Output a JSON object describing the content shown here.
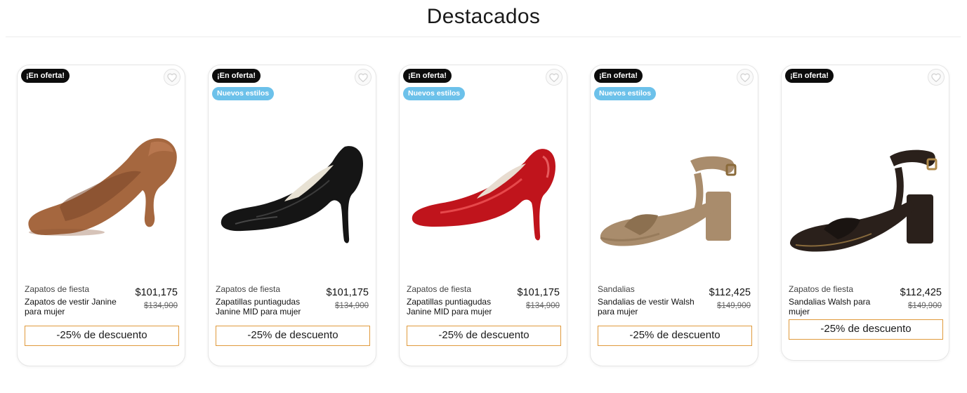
{
  "section": {
    "title": "Destacados"
  },
  "products": [
    {
      "offer_badge": "¡En oferta!",
      "new_badge": "",
      "category": "Zapatos de fiesta",
      "name": "Zapatos de vestir Janine para mujer",
      "price": "$101,175",
      "old_price": "$134,900",
      "discount": "-25% de descuento",
      "image": "tan-pump-image",
      "color": "#a5673f"
    },
    {
      "offer_badge": "¡En oferta!",
      "new_badge": "Nuevos estilos",
      "category": "Zapatos de fiesta",
      "name": "Zapatillas puntiagudas Janine MID para mujer",
      "price": "$101,175",
      "old_price": "$134,900",
      "discount": "-25% de descuento",
      "image": "black-pump-image",
      "color": "#151515"
    },
    {
      "offer_badge": "¡En oferta!",
      "new_badge": "Nuevos estilos",
      "category": "Zapatos de fiesta",
      "name": "Zapatillas puntiagudas Janine MID para mujer",
      "price": "$101,175",
      "old_price": "$134,900",
      "discount": "-25% de descuento",
      "image": "red-pump-image",
      "color": "#c0141c"
    },
    {
      "offer_badge": "¡En oferta!",
      "new_badge": "Nuevos estilos",
      "category": "Sandalias",
      "name": "Sandalias de vestir Walsh para mujer",
      "price": "$112,425",
      "old_price": "$149,900",
      "discount": "-25% de descuento",
      "image": "taupe-sandal-image",
      "color": "#a98c6c"
    },
    {
      "offer_badge": "¡En oferta!",
      "new_badge": "",
      "category": "Zapatos de fiesta",
      "name": "Sandalias Walsh para mujer",
      "price": "$112,425",
      "old_price": "$149,900",
      "discount": "-25% de descuento",
      "image": "black-sandal-image",
      "color": "#2a201b"
    }
  ],
  "colors": {
    "offer_badge_bg": "#0c0c0c",
    "new_badge_bg": "#6cc1ea",
    "discount_border": "#e09a3c"
  }
}
